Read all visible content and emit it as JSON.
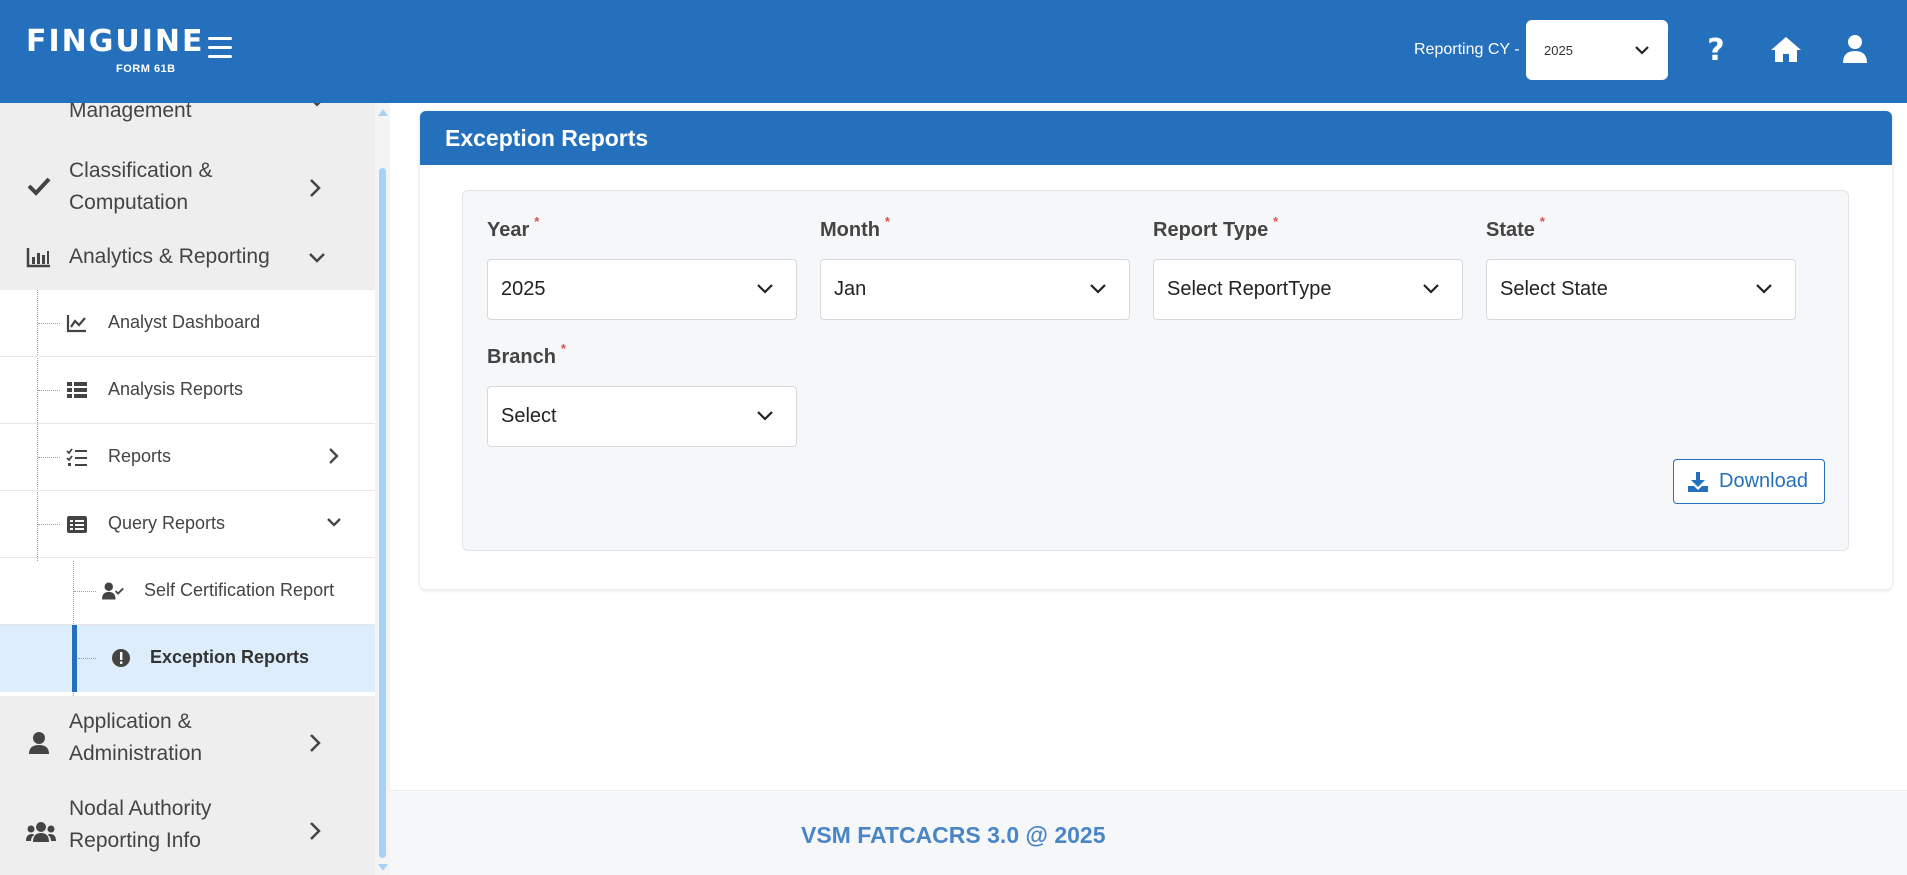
{
  "header": {
    "logo_text": "FINGUINE",
    "logo_sub": "FORM 61B",
    "cy_label": "Reporting CY -",
    "cy_value": "2025"
  },
  "sidebar": {
    "partial_item": "Management",
    "items": [
      {
        "label_line1": "Classification &",
        "label_line2": "Computation",
        "icon": "check-icon"
      },
      {
        "label": "Analytics & Reporting",
        "icon": "bar-chart-icon"
      },
      {
        "label_line1": "Application &",
        "label_line2": "Administration",
        "icon": "user-icon"
      },
      {
        "label_line1": "Nodal Authority",
        "label_line2": "Reporting Info",
        "icon": "users-icon"
      }
    ],
    "sub_items": [
      {
        "label": "Analyst Dashboard",
        "icon": "line-chart-icon"
      },
      {
        "label": "Analysis Reports",
        "icon": "table-icon"
      },
      {
        "label": "Reports",
        "icon": "checklist-icon"
      },
      {
        "label": "Query Reports",
        "icon": "list-alt-icon"
      }
    ],
    "query_sub_items": [
      {
        "label": "Self Certification Report",
        "icon": "user-check-icon"
      },
      {
        "label": "Exception Reports",
        "icon": "exclamation-circle-icon"
      }
    ]
  },
  "main": {
    "card_title": "Exception Reports",
    "fields": {
      "year": {
        "label": "Year",
        "value": "2025"
      },
      "month": {
        "label": "Month",
        "value": "Jan"
      },
      "report_type": {
        "label": "Report Type",
        "value": "Select ReportType"
      },
      "state": {
        "label": "State",
        "value": "Select State"
      },
      "branch": {
        "label": "Branch",
        "value": "Select"
      }
    },
    "required_mark": "*",
    "download_label": "Download"
  },
  "footer": {
    "text": "VSM FATCACRS 3.0 @ 2025"
  },
  "colors": {
    "primary": "#2470bd",
    "sidebar_bg": "#eeeeee",
    "active_bg": "#ddedfb",
    "footer_text": "#4a86c5",
    "required": "#d9534f"
  }
}
